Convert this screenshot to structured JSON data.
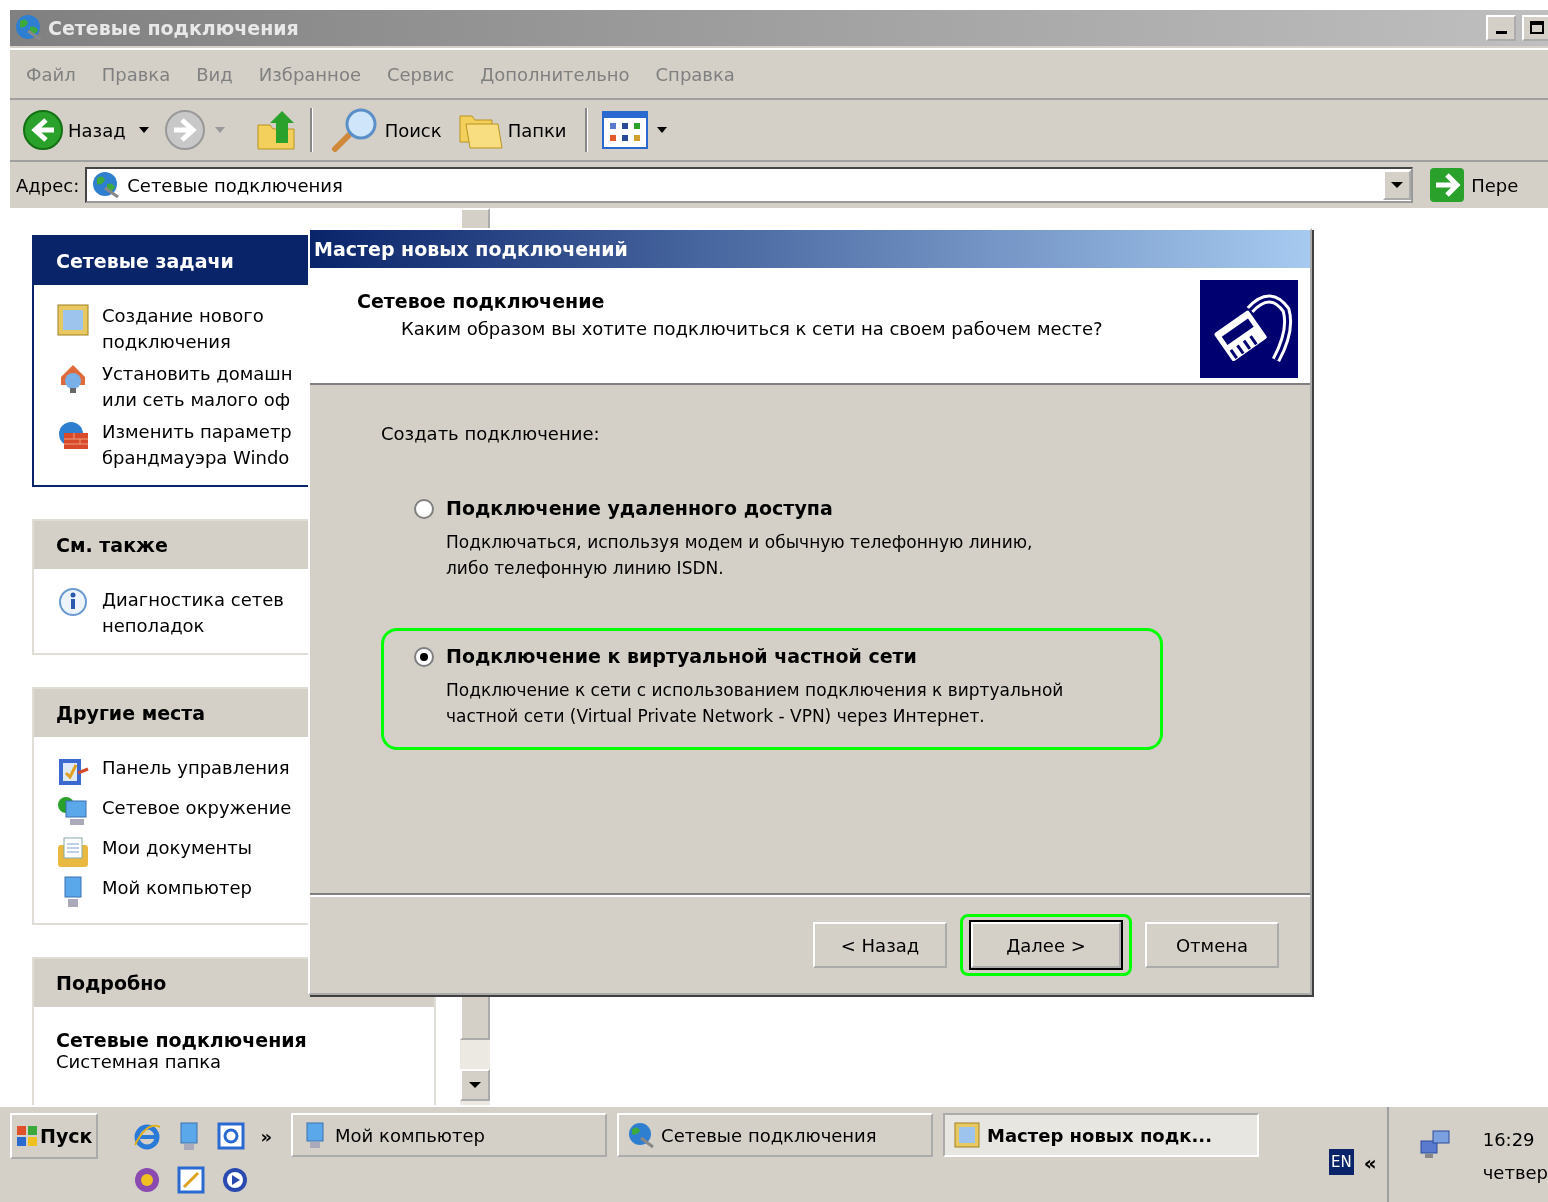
{
  "window": {
    "title": "Сетевые подключения"
  },
  "menu": [
    "Файл",
    "Правка",
    "Вид",
    "Избранное",
    "Сервис",
    "Дополнительно",
    "Справка"
  ],
  "toolbar": {
    "back": "Назад",
    "search": "Поиск",
    "folders": "Папки"
  },
  "address": {
    "label": "Адрес:",
    "value": "Сетевые подключения",
    "go": "Пере"
  },
  "task_panels": [
    {
      "title": "Сетевые задачи",
      "kind": "special",
      "items": [
        {
          "lines": [
            "Создание нового",
            "подключения"
          ]
        },
        {
          "lines": [
            "Установить домашн",
            "или сеть малого оф"
          ]
        },
        {
          "lines": [
            "Изменить параметр",
            "брандмауэра Windo"
          ]
        }
      ]
    },
    {
      "title": "См. также",
      "kind": "normal",
      "items": [
        {
          "lines": [
            "Диагностика сетев",
            "неполадок"
          ]
        }
      ]
    },
    {
      "title": "Другие места",
      "kind": "normal",
      "items": [
        {
          "lines": [
            "Панель управления"
          ]
        },
        {
          "lines": [
            "Сетевое окружение"
          ]
        },
        {
          "lines": [
            "Мои документы"
          ]
        },
        {
          "lines": [
            "Мой компьютер"
          ]
        }
      ]
    }
  ],
  "details": {
    "title": "Подробно",
    "name": "Сетевые подключения",
    "type": "Системная папка"
  },
  "dialog": {
    "title": "Мастер новых подключений",
    "heading": "Сетевое подключение",
    "subheading": "Каким образом вы хотите подключиться к сети на своем рабочем месте?",
    "prompt": "Создать подключение:",
    "options": [
      {
        "label": "Подключение удаленного доступа",
        "description": [
          "Подключаться, используя модем и обычную телефонную линию,",
          "либо телефонную линию ISDN."
        ],
        "selected": false,
        "highlighted": false
      },
      {
        "label": "Подключение к виртуальной частной сети",
        "description": [
          "Подключение к сети с использованием подключения к виртуальной",
          "частной сети (Virtual Private Network - VPN) через Интернет."
        ],
        "selected": true,
        "highlighted": true
      }
    ],
    "buttons": [
      {
        "label": "< Назад",
        "default": false,
        "highlighted": false
      },
      {
        "label": "Далее >",
        "default": true,
        "highlighted": true
      },
      {
        "label": "Отмена",
        "default": false,
        "highlighted": false
      }
    ]
  },
  "taskbar": {
    "start": "Пуск",
    "more": "»",
    "tasks": [
      {
        "label": "Мой компьютер",
        "selected": false
      },
      {
        "label": "Сетевые подключения",
        "selected": false
      },
      {
        "label": "Мастер новых подк...",
        "selected": true
      }
    ],
    "language": "EN",
    "expand": "«",
    "time": "16:29",
    "day": "четвер"
  }
}
